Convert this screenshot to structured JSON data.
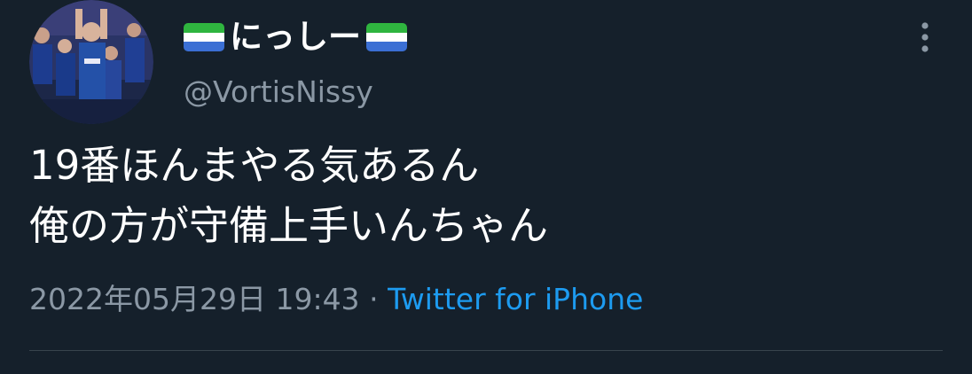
{
  "tweet": {
    "display_name": "にっしー",
    "handle": "@VortisNissy",
    "text_lines": [
      "19番ほんまやる気あるん",
      "俺の方が守備上手いんちゃん"
    ],
    "timestamp": "2022年05月29日 19:43",
    "separator": "·",
    "source": "Twitter for iPhone"
  },
  "icons": {
    "more": "more-vertical-icon",
    "flag": "sierra-leone-flag-icon"
  },
  "colors": {
    "background": "#15202b",
    "text": "#ffffff",
    "secondary_text": "#8b98a5",
    "link": "#1d9bf0",
    "divider": "#38444d"
  }
}
